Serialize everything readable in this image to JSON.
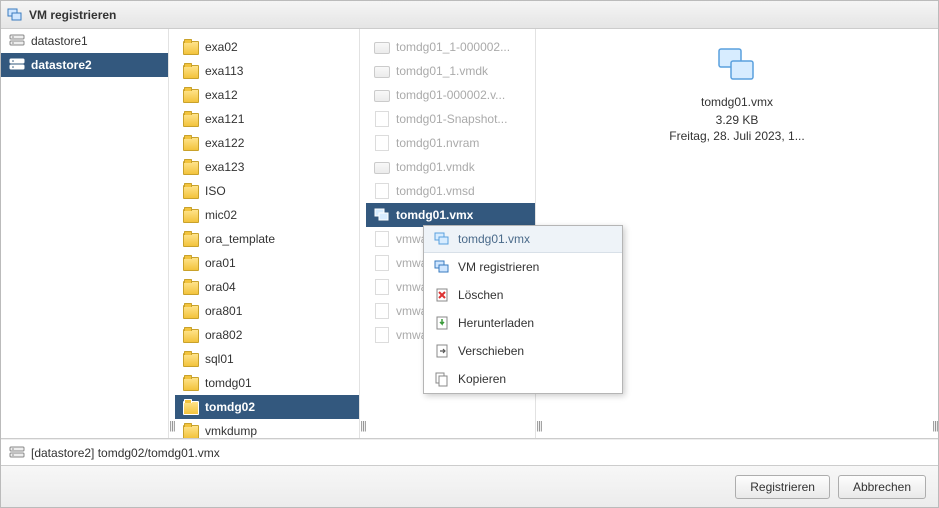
{
  "dialog": {
    "title": "VM registrieren"
  },
  "datastores": [
    {
      "name": "datastore1",
      "selected": false
    },
    {
      "name": "datastore2",
      "selected": true
    }
  ],
  "folders": [
    {
      "name": "exa02",
      "truncated": true
    },
    {
      "name": "exa113"
    },
    {
      "name": "exa12"
    },
    {
      "name": "exa121"
    },
    {
      "name": "exa122"
    },
    {
      "name": "exa123"
    },
    {
      "name": "ISO"
    },
    {
      "name": "mic02"
    },
    {
      "name": "ora_template"
    },
    {
      "name": "ora01"
    },
    {
      "name": "ora04"
    },
    {
      "name": "ora801"
    },
    {
      "name": "ora802"
    },
    {
      "name": "sql01"
    },
    {
      "name": "tomdg01"
    },
    {
      "name": "tomdg02",
      "selected": true
    },
    {
      "name": "vmkdump"
    }
  ],
  "files": [
    {
      "name": "tomdg01_1-000002...",
      "type": "vmdk",
      "grey": true
    },
    {
      "name": "tomdg01_1.vmdk",
      "type": "vmdk",
      "grey": true
    },
    {
      "name": "tomdg01-000002.v...",
      "type": "vmdk",
      "grey": true
    },
    {
      "name": "tomdg01-Snapshot...",
      "type": "file",
      "grey": true
    },
    {
      "name": "tomdg01.nvram",
      "type": "file",
      "grey": true
    },
    {
      "name": "tomdg01.vmdk",
      "type": "vmdk",
      "grey": true
    },
    {
      "name": "tomdg01.vmsd",
      "type": "file",
      "grey": true
    },
    {
      "name": "tomdg01.vmx",
      "type": "vmx",
      "selected": true
    },
    {
      "name": "vmwa...",
      "type": "file",
      "grey": true
    },
    {
      "name": "vmwa...",
      "type": "file",
      "grey": true
    },
    {
      "name": "vmwa...",
      "type": "file",
      "grey": true
    },
    {
      "name": "vmwa...",
      "type": "file",
      "grey": true
    },
    {
      "name": "vmwa...",
      "type": "file",
      "grey": true
    }
  ],
  "detail": {
    "name": "tomdg01.vmx",
    "size": "3.29 KB",
    "date": "Freitag, 28. Juli 2023, 1..."
  },
  "path": "[datastore2] tomdg02/tomdg01.vmx",
  "context_menu": {
    "header": "tomdg01.vmx",
    "items": [
      {
        "icon": "vm-register-icon",
        "label": "VM registrieren"
      },
      {
        "icon": "delete-icon",
        "label": "Löschen"
      },
      {
        "icon": "download-icon",
        "label": "Herunterladen"
      },
      {
        "icon": "move-icon",
        "label": "Verschieben"
      },
      {
        "icon": "copy-icon",
        "label": "Kopieren"
      }
    ]
  },
  "buttons": {
    "register": "Registrieren",
    "cancel": "Abbrechen"
  }
}
